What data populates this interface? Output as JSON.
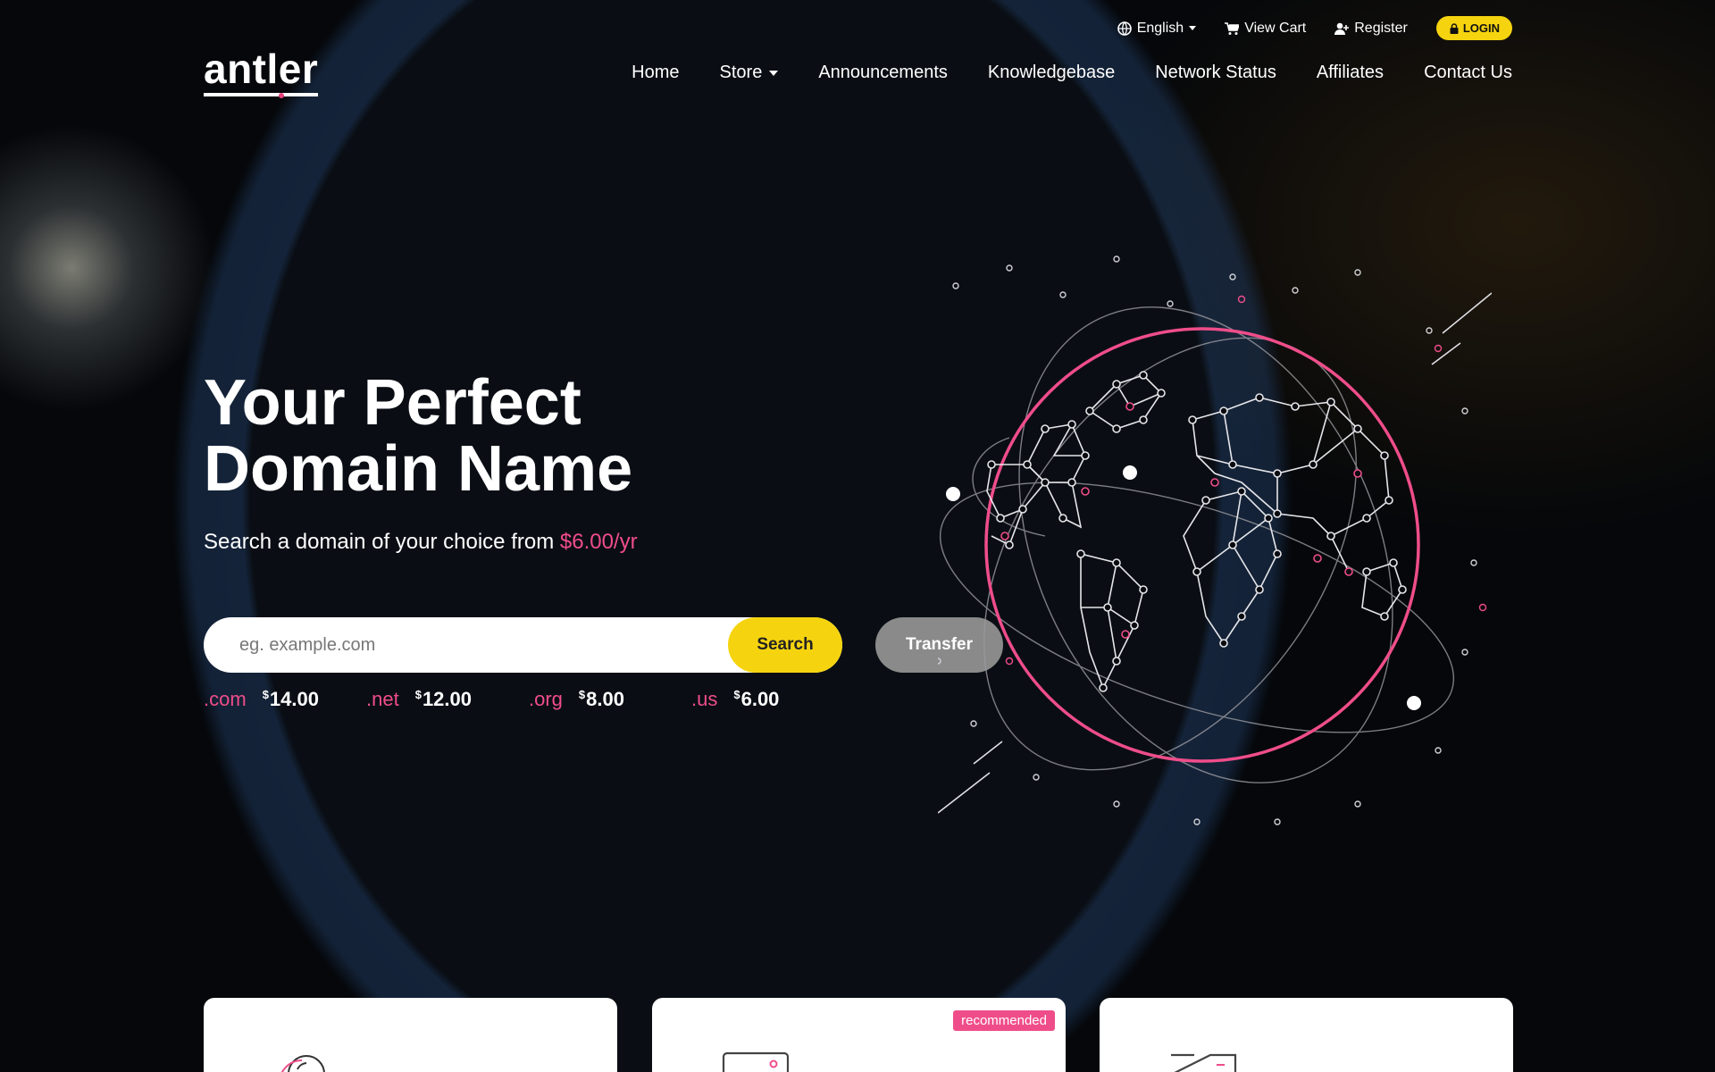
{
  "topbar": {
    "language": "English",
    "view_cart": "View Cart",
    "register": "Register",
    "login": "LOGIN"
  },
  "logo": {
    "text": "antler"
  },
  "nav": {
    "home": "Home",
    "store": "Store",
    "announcements": "Announcements",
    "knowledgebase": "Knowledgebase",
    "network_status": "Network Status",
    "affiliates": "Affiliates",
    "contact_us": "Contact Us"
  },
  "hero": {
    "title_line1": "Your Perfect",
    "title_line2": "Domain Name",
    "subtitle": "Search a domain of your choice from",
    "subtitle_price": "$6.00/yr",
    "search_placeholder": "eg. example.com",
    "search_button": "Search",
    "transfer_button": "Transfer"
  },
  "tlds": [
    {
      "ext": ".com",
      "currency": "$",
      "price": "14.00"
    },
    {
      "ext": ".net",
      "currency": "$",
      "price": "12.00"
    },
    {
      "ext": ".org",
      "currency": "$",
      "price": "8.00"
    },
    {
      "ext": ".us",
      "currency": "$",
      "price": "6.00"
    }
  ],
  "cards": {
    "recommended_badge": "recommended"
  },
  "colors": {
    "accent_yellow": "#f5d40f",
    "accent_pink": "#ef4d8a",
    "button_gray": "#8a8a8a"
  },
  "icons": [
    "globe-icon",
    "cart-icon",
    "user-plus-icon",
    "lock-icon",
    "caret-down-icon"
  ]
}
